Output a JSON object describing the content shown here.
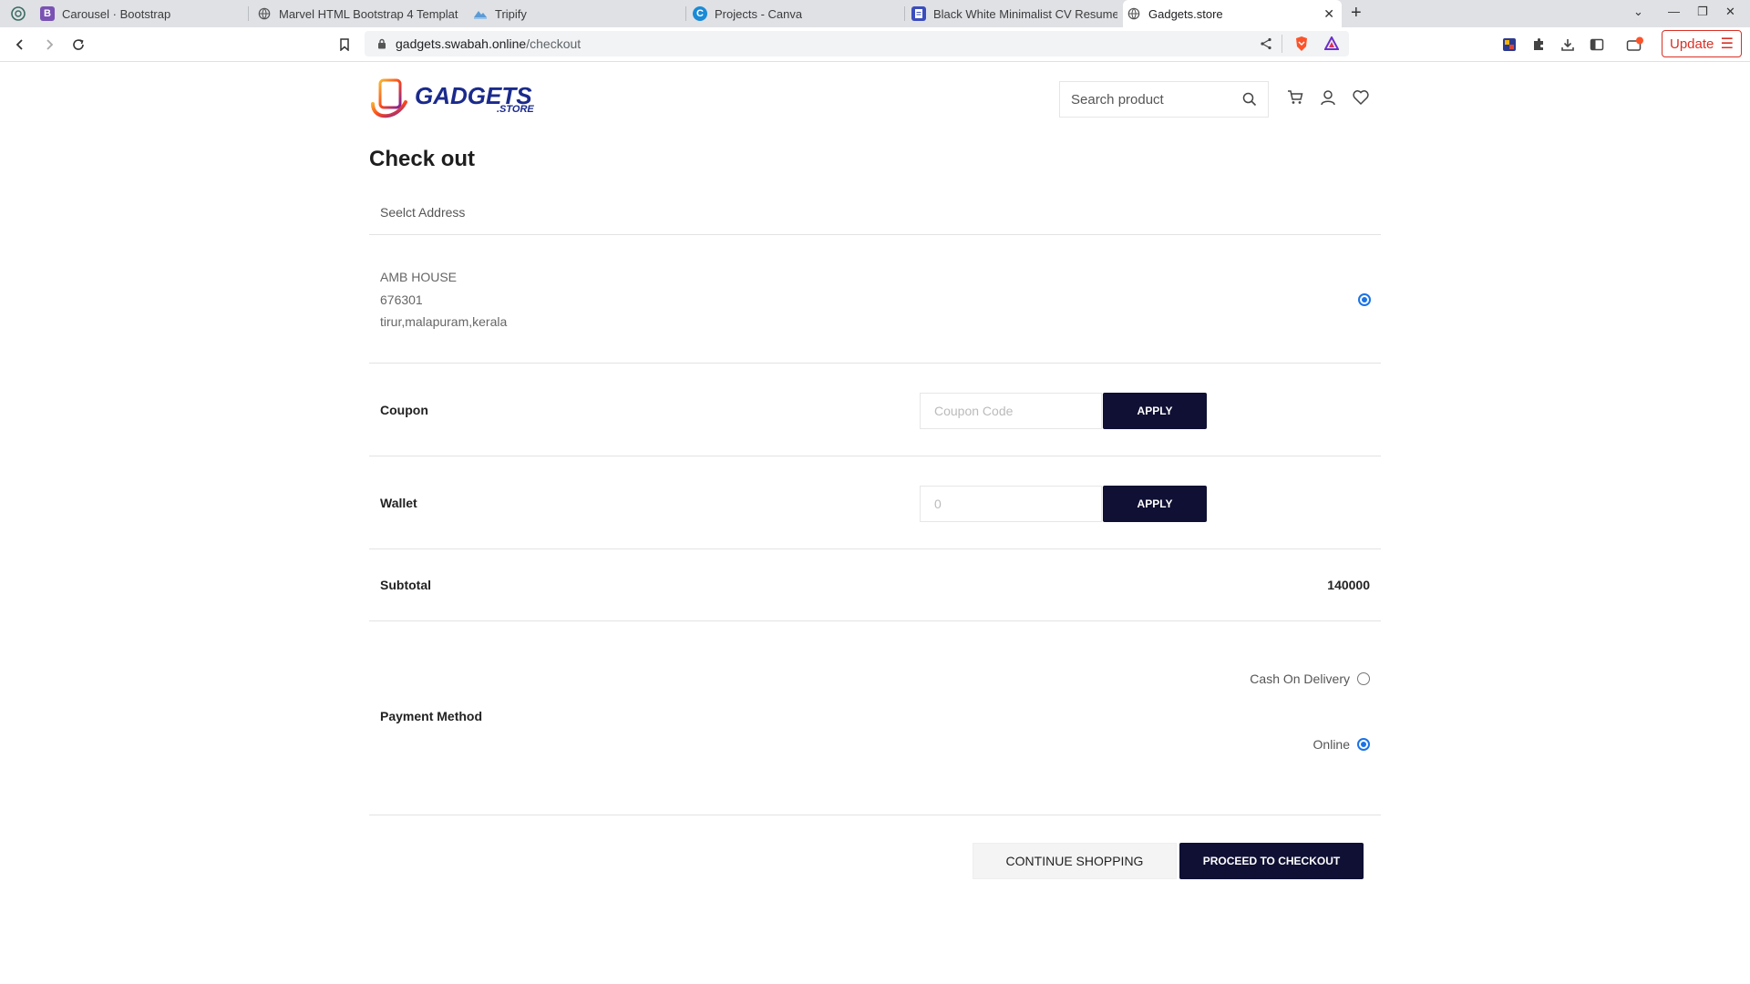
{
  "browser": {
    "tabs": [
      {
        "title": "Carousel · Bootstrap",
        "icon": "bootstrap-icon"
      },
      {
        "title": "Marvel HTML Bootstrap 4 Templat",
        "icon": "globe-icon"
      },
      {
        "title": "Tripify",
        "icon": "tripify-icon"
      },
      {
        "title": "Projects - Canva",
        "icon": "canva-icon"
      },
      {
        "title": "Black White Minimalist CV Resume",
        "icon": "doc-icon"
      },
      {
        "title": "Gadgets.store",
        "icon": "globe-icon",
        "active": true
      }
    ],
    "url_host": "gadgets.swabah.online",
    "url_path": "/checkout",
    "update_label": "Update"
  },
  "header": {
    "logo_text": "GADGETS",
    "logo_suffix": ".STORE",
    "search_placeholder": "Search product"
  },
  "checkout": {
    "title": "Check out",
    "address_section_label": "Seelct Address",
    "address": {
      "line1": "AMB HOUSE",
      "line2": "676301",
      "line3": "tirur,malapuram,kerala",
      "selected": true
    },
    "coupon": {
      "label": "Coupon",
      "placeholder": "Coupon Code",
      "button": "APPLY"
    },
    "wallet": {
      "label": "Wallet",
      "placeholder": "0",
      "button": "APPLY"
    },
    "subtotal": {
      "label": "Subtotal",
      "value": "140000"
    },
    "payment": {
      "label": "Payment Method",
      "options": [
        {
          "label": "Cash On Delivery",
          "selected": false
        },
        {
          "label": "Online",
          "selected": true
        }
      ]
    },
    "actions": {
      "continue": "CONTINUE SHOPPING",
      "proceed": "PROCEED TO CHECKOUT"
    }
  },
  "colors": {
    "primary_dark": "#0f1033",
    "radio_blue": "#1a73e8",
    "update_red": "#d93025"
  }
}
